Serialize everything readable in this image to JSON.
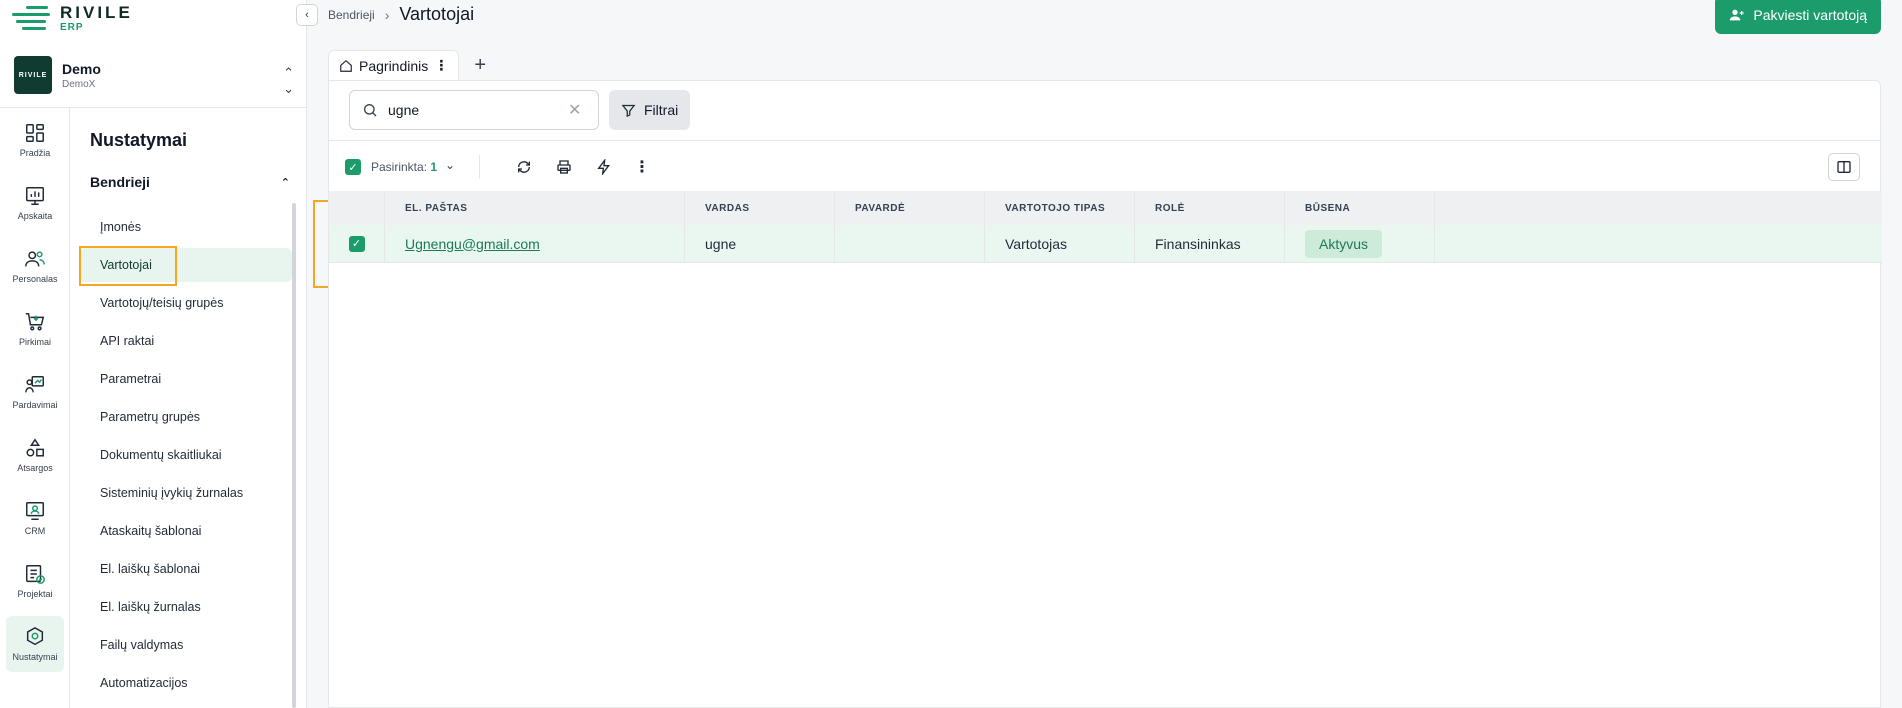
{
  "brand": {
    "name": "RIVILE",
    "sub": "ERP",
    "accent": "#1b9c6a"
  },
  "company": {
    "name": "Demo",
    "sub": "DemoX",
    "logo_text": "RIVILE"
  },
  "rail": [
    {
      "label": "Pradžia",
      "icon": "dashboard-icon"
    },
    {
      "label": "Apskaita",
      "icon": "chart-icon"
    },
    {
      "label": "Personalas",
      "icon": "people-icon"
    },
    {
      "label": "Pirkimai",
      "icon": "cart-icon"
    },
    {
      "label": "Pardavimai",
      "icon": "sales-icon"
    },
    {
      "label": "Atsargos",
      "icon": "shapes-icon"
    },
    {
      "label": "CRM",
      "icon": "crm-icon"
    },
    {
      "label": "Projektai",
      "icon": "project-icon"
    },
    {
      "label": "Nustatymai",
      "icon": "settings-icon"
    }
  ],
  "subnav": {
    "title": "Nustatymai",
    "group": "Bendrieji",
    "items": [
      "Įmonės",
      "Vartotojai",
      "Vartotojų/teisių grupės",
      "API raktai",
      "Parametrai",
      "Parametrų grupės",
      "Dokumentų skaitliukai",
      "Sisteminių įvykių žurnalas",
      "Ataskaitų šablonai",
      "El. laiškų šablonai",
      "El. laiškų žurnalas",
      "Failų valdymas",
      "Automatizacijos"
    ]
  },
  "header": {
    "breadcrumb_parent": "Bendrieji",
    "breadcrumb_sep": "›",
    "title": "Vartotojai",
    "invite_label": "Pakviesti vartotoją"
  },
  "tabs": [
    {
      "label": "Pagrindinis"
    }
  ],
  "search": {
    "value": "ugne",
    "clear": "✕"
  },
  "filter_label": "Filtrai",
  "toolbar": {
    "selected_label": "Pasirinkta:",
    "selected_count": "1"
  },
  "table": {
    "columns": [
      "",
      "EL. PAŠTAS",
      "VARDAS",
      "PAVARDĖ",
      "VARTOTOJO TIPAS",
      "ROLĖ",
      "BŪSENA",
      ""
    ],
    "rows": [
      {
        "email": "Ugnengu@gmail.com",
        "first": "ugne",
        "last": "",
        "type": "Vartotojas",
        "role": "Finansininkas",
        "status": "Aktyvus"
      }
    ]
  }
}
